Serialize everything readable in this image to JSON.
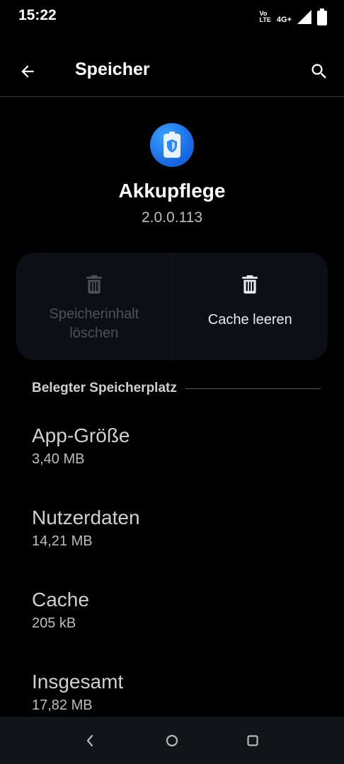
{
  "status_bar": {
    "time": "15:22",
    "volte_top": "Vo",
    "volte_bottom": "LTE",
    "network": "4G+"
  },
  "app_bar": {
    "title": "Speicher"
  },
  "app": {
    "name": "Akkupflege",
    "version": "2.0.0.113"
  },
  "actions": {
    "clear_storage_line1": "Speicherinhalt",
    "clear_storage_line2": "löschen",
    "clear_cache": "Cache leeren"
  },
  "section": {
    "title": "Belegter Speicherplatz"
  },
  "rows": [
    {
      "title": "App-Größe",
      "value": "3,40 MB"
    },
    {
      "title": "Nutzerdaten",
      "value": "14,21 MB"
    },
    {
      "title": "Cache",
      "value": "205 kB"
    },
    {
      "title": "Insgesamt",
      "value": "17,82 MB"
    }
  ],
  "colors": {
    "background": "#000000",
    "card": "#0c1016",
    "accent": "#1e7bf0",
    "nav_bar": "#111519"
  },
  "icons": {
    "back": "arrow-back-icon",
    "search": "search-icon",
    "app": "battery-shield-icon",
    "trash": "trash-icon",
    "nav_back": "nav-back-icon",
    "nav_home": "nav-home-icon",
    "nav_recents": "nav-recents-icon"
  }
}
